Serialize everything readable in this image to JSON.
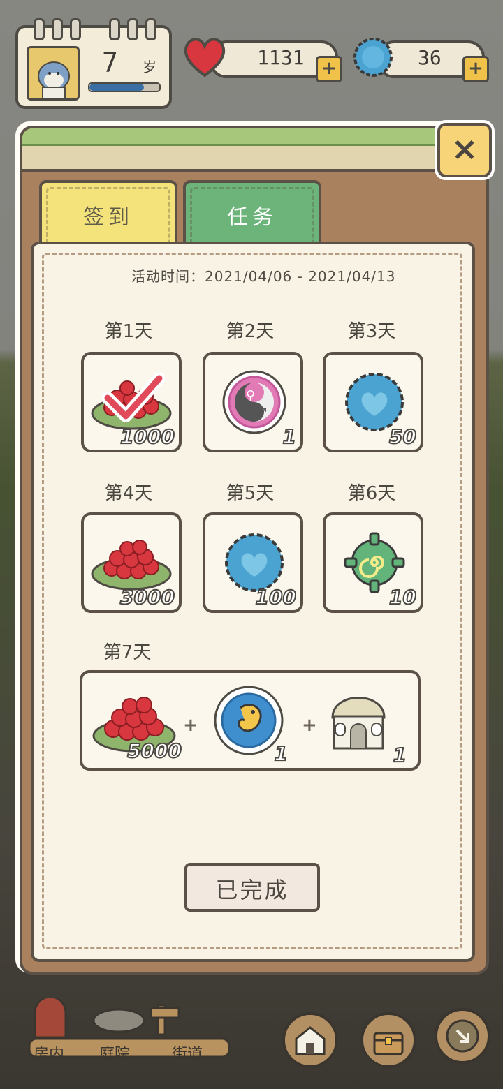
{
  "hud": {
    "age_value": "7",
    "age_unit": "岁",
    "age_progress": 0.78,
    "hearts_value": "1131",
    "caps_value": "36"
  },
  "dialog": {
    "close_label": "×",
    "tabs": [
      {
        "label": "签到",
        "active": true
      },
      {
        "label": "任务",
        "active": false
      }
    ],
    "period": "活动时间：2021/04/06 - 2021/04/13",
    "days": [
      {
        "label": "第1天",
        "item": "hearts-plate-icon",
        "qty": "1000",
        "claimed": true
      },
      {
        "label": "第2天",
        "item": "gender-swap-icon",
        "qty": "1",
        "claimed": false
      },
      {
        "label": "第3天",
        "item": "blue-cap-icon",
        "qty": "50",
        "claimed": false
      },
      {
        "label": "第4天",
        "item": "hearts-plate-icon",
        "qty": "3000",
        "claimed": false
      },
      {
        "label": "第5天",
        "item": "blue-cap-icon",
        "qty": "100",
        "claimed": false
      },
      {
        "label": "第6天",
        "item": "green-gear-icon",
        "qty": "10",
        "claimed": false
      }
    ],
    "day7": {
      "label": "第7天",
      "items": [
        {
          "item": "hearts-plate-icon",
          "qty": "5000"
        },
        {
          "item": "embryo-orb-icon",
          "qty": "1"
        },
        {
          "item": "dome-house-icon",
          "qty": "1"
        }
      ],
      "plus": "+"
    },
    "done_label": "已完成"
  },
  "nav": {
    "house": "房内",
    "yard": "庭院",
    "street": "街道"
  },
  "colors": {
    "heart_red": "#d8373f",
    "cap_blue": "#4aa3d0",
    "tab_yellow": "#f4e27a",
    "tab_green": "#6db47a",
    "panel": "#f8f3e5",
    "frame": "#a9815e"
  }
}
